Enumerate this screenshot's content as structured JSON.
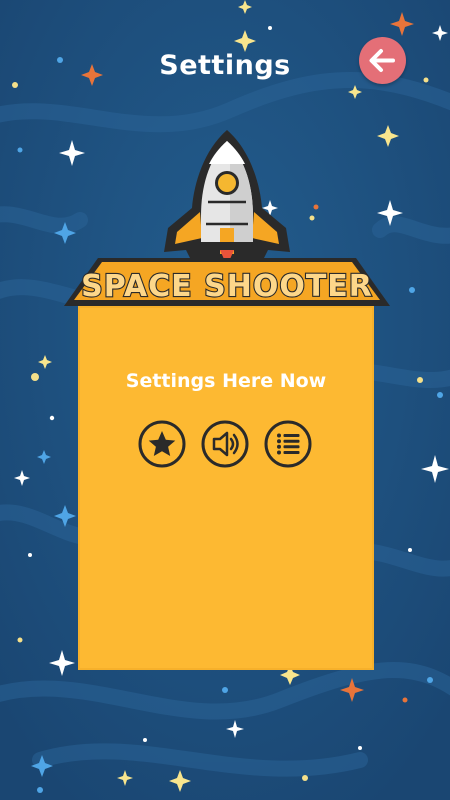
{
  "header": {
    "title": "Settings",
    "back_icon": "arrow-left-icon"
  },
  "logo": {
    "text": "SPACE SHOOTER",
    "icon": "rocket-icon"
  },
  "panel": {
    "message": "Settings Here Now",
    "buttons": [
      {
        "icon": "star-icon"
      },
      {
        "icon": "speaker-icon"
      },
      {
        "icon": "list-icon"
      }
    ]
  },
  "colors": {
    "background": "#1d4f7c",
    "panel": "#fdb932",
    "back_button": "#e46f77",
    "outline": "#2a2a2a"
  }
}
